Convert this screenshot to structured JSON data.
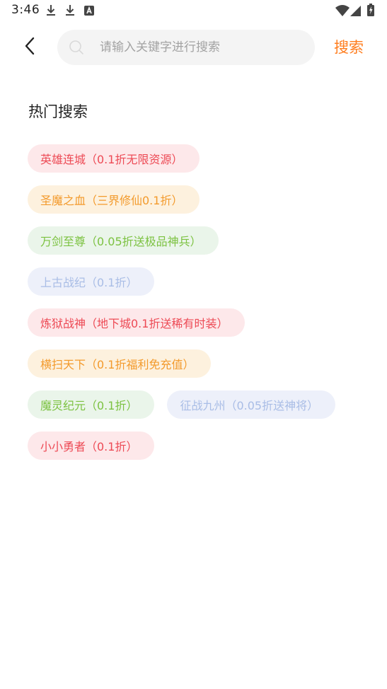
{
  "status_bar": {
    "time": "3:46",
    "icons": [
      "download-icon",
      "download-icon",
      "notification-a-icon",
      "wifi-icon",
      "signal-icon",
      "battery-icon"
    ]
  },
  "header": {
    "back_icon": "chevron-left-icon",
    "search_icon": "search-icon",
    "search_placeholder": "请输入关键字进行搜索",
    "search_value": "",
    "search_button": "搜索",
    "accent_color": "#ff7d1e"
  },
  "hot_search": {
    "title": "热门搜索",
    "tags": [
      {
        "label": "英雄连城（0.1折无限资源）",
        "color": "red"
      },
      {
        "label": "圣魔之血（三界修仙0.1折）",
        "color": "orange"
      },
      {
        "label": "万剑至尊（0.05折送极品神兵）",
        "color": "green"
      },
      {
        "label": "上古战纪（0.1折）",
        "color": "blue"
      },
      {
        "label": "炼狱战神（地下城0.1折送稀有时装）",
        "color": "red"
      },
      {
        "label": "横扫天下（0.1折福利免充值）",
        "color": "orange"
      },
      {
        "label": "魔灵纪元（0.1折）",
        "color": "green"
      },
      {
        "label": "征战九州（0.05折送神将）",
        "color": "blue"
      },
      {
        "label": "小小勇者（0.1折）",
        "color": "red"
      }
    ],
    "tag_colors": {
      "red": {
        "bg": "#fde8ea",
        "text": "#ed4a55"
      },
      "orange": {
        "bg": "#fdf1de",
        "text": "#f39a2c"
      },
      "green": {
        "bg": "#eaf5ea",
        "text": "#7cc241"
      },
      "blue": {
        "bg": "#edf0fa",
        "text": "#a9bde6"
      }
    }
  }
}
